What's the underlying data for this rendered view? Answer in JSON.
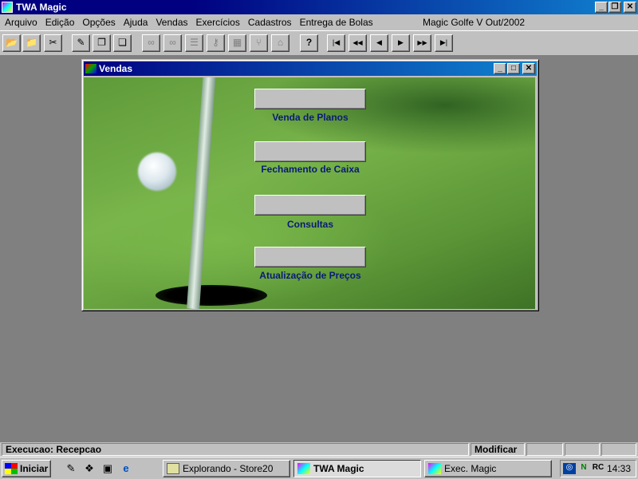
{
  "app": {
    "title": "TWA Magic"
  },
  "menu": {
    "items": [
      "Arquivo",
      "Edição",
      "Opções",
      "Ajuda",
      "Vendas",
      "Exercícios",
      "Cadastros",
      "Entrega de Bolas"
    ],
    "version": "Magic Golfe V Out/2002"
  },
  "toolbar": {
    "buttons": [
      {
        "icon": "open-folder-icon",
        "glyph": "📂"
      },
      {
        "icon": "open-file-icon",
        "glyph": "📁"
      },
      {
        "icon": "tools-icon",
        "glyph": "✂"
      },
      {
        "icon": "edit-icon",
        "glyph": "✎"
      },
      {
        "icon": "copy-icon",
        "glyph": "❐"
      },
      {
        "icon": "pages-icon",
        "glyph": "❏"
      },
      {
        "icon": "binoculars-icon",
        "glyph": "∞"
      },
      {
        "icon": "find-icon",
        "glyph": "∞"
      },
      {
        "icon": "list-icon",
        "glyph": "☰"
      },
      {
        "icon": "key-icon",
        "glyph": "⚷"
      },
      {
        "icon": "grid-icon",
        "glyph": "▦"
      },
      {
        "icon": "branch-icon",
        "glyph": "⑂"
      },
      {
        "icon": "home-icon",
        "glyph": "⌂"
      },
      {
        "icon": "help-icon",
        "glyph": "?"
      },
      {
        "icon": "first-record-icon",
        "glyph": "|◀"
      },
      {
        "icon": "prev-page-icon",
        "glyph": "◀◀"
      },
      {
        "icon": "prev-record-icon",
        "glyph": "◀"
      },
      {
        "icon": "next-record-icon",
        "glyph": "▶"
      },
      {
        "icon": "next-page-icon",
        "glyph": "▶▶"
      },
      {
        "icon": "last-record-icon",
        "glyph": "▶|"
      }
    ]
  },
  "vendas": {
    "title": "Vendas",
    "buttons": [
      {
        "label": "Venda de Planos"
      },
      {
        "label": "Fechamento de Caixa"
      },
      {
        "label": "Consultas"
      },
      {
        "label": "Atualização de Preços"
      }
    ]
  },
  "status": {
    "mode": "Execucao: Recepcao",
    "action": "Modificar"
  },
  "taskbar": {
    "start": "Iniciar",
    "tasks": [
      {
        "label": "Explorando - Store20",
        "active": false
      },
      {
        "label": "TWA Magic",
        "active": true
      },
      {
        "label": "Exec. Magic",
        "active": false
      }
    ],
    "clock": "14:33"
  }
}
